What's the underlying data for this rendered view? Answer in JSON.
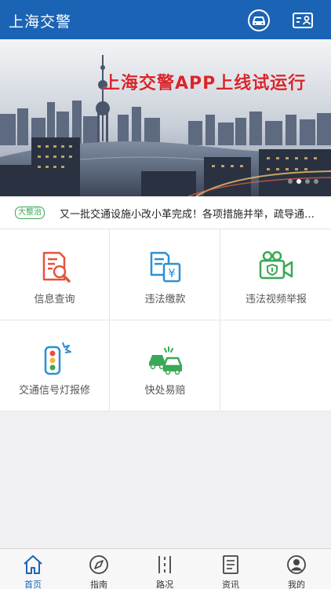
{
  "header": {
    "title": "上海交警",
    "car_icon": "car-icon",
    "id_icon": "id-card-icon"
  },
  "banner": {
    "headline": "上海交警APP上线试运行",
    "slide_count": 4,
    "active_slide": 1
  },
  "notice": {
    "tag": "大整治",
    "text": "又一批交通设施小改小革完成！各项措施并举，疏导通行..."
  },
  "services": [
    {
      "label": "信息查询",
      "icon": "document-search-icon",
      "color": "#e4533c"
    },
    {
      "label": "违法缴款",
      "icon": "payment-icon",
      "color": "#2c8fd6"
    },
    {
      "label": "违法视频举报",
      "icon": "video-report-icon",
      "color": "#3aa855"
    },
    {
      "label": "交通信号灯报修",
      "icon": "traffic-light-icon",
      "color": "#2c8fd6"
    },
    {
      "label": "快处易赔",
      "icon": "car-accident-icon",
      "color": "#3aa855"
    }
  ],
  "tabs": [
    {
      "label": "首页",
      "icon": "home-icon"
    },
    {
      "label": "指南",
      "icon": "compass-icon"
    },
    {
      "label": "路况",
      "icon": "road-icon"
    },
    {
      "label": "资讯",
      "icon": "news-icon"
    },
    {
      "label": "我的",
      "icon": "user-icon"
    }
  ],
  "active_tab": 0,
  "colors": {
    "primary": "#1b63b5",
    "accent_red": "#e4533c",
    "accent_green": "#3aa855",
    "accent_blue": "#2c8fd6"
  }
}
